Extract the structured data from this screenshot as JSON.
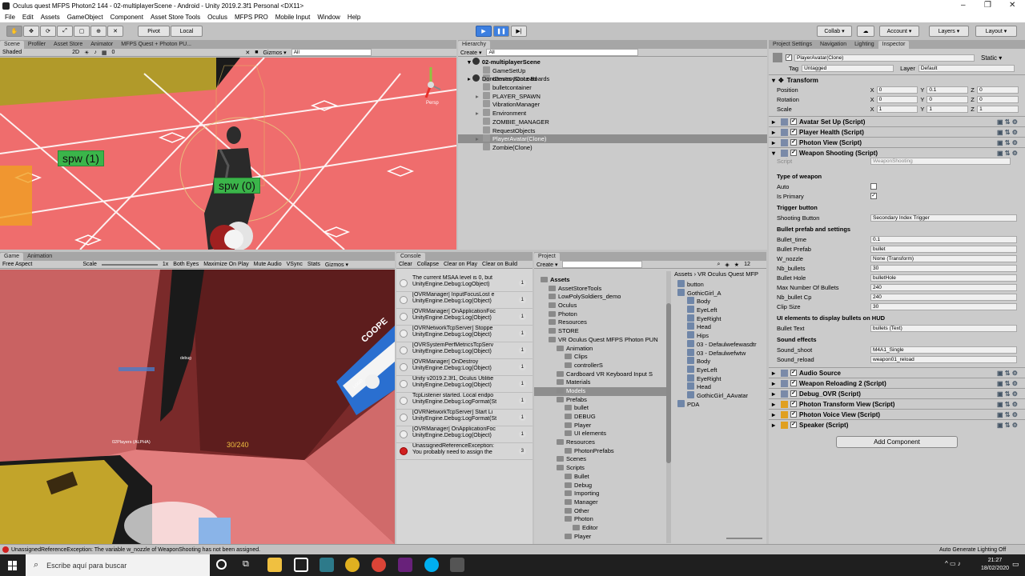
{
  "window": {
    "title": "Oculus quest MFPS Photon2 144 - 02-multiplayerScene - Android - Unity 2019.2.3f1 Personal <DX11>",
    "minimize": "–",
    "maximize": "❐",
    "close": "✕"
  },
  "menu": [
    "File",
    "Edit",
    "Assets",
    "GameObject",
    "Component",
    "Asset Store Tools",
    "Oculus",
    "MFPS PRO",
    "Mobile Input",
    "Window",
    "Help"
  ],
  "toolbar": {
    "pivot": "Pivot",
    "local": "Local",
    "collab": "Collab ▾",
    "account": "Account ▾",
    "layers": "Layers ▾",
    "layout": "Layout ▾"
  },
  "scene": {
    "tabs": [
      "Scene",
      "Profiler",
      "Asset Store",
      "Animator",
      "MFPS Quest + Photon PU..."
    ],
    "shaded": "Shaded",
    "mode2d": "2D",
    "gizmos": "Gizmos ▾",
    "search": "All",
    "persp": "Persp",
    "spw1": "spw (1)",
    "spw0": "spw (0)",
    "zero": "0"
  },
  "game": {
    "tabs": [
      "Game",
      "Animation"
    ],
    "aspect": "Free Aspect",
    "scale": "Scale",
    "scale_val": "1x",
    "both_eyes": "Both Eyes",
    "maximize": "Maximize On Play",
    "mute": "Mute Audio",
    "vsync": "VSync",
    "stats": "Stats",
    "gizmos": "Gizmos ▾",
    "ammo": "30/240",
    "player_label": "02Players (ALPHA)",
    "debug": "debug",
    "sign": "COOPE",
    "sign2": "LOGO"
  },
  "hierarchy": {
    "tab": "Hierarchy",
    "create": "Create ▾",
    "search": "All",
    "scene": "02-multiplayerScene",
    "items": [
      "GameSetUp",
      "canvas Score Boards",
      "bulletcontainer",
      "PLAYER_SPAWN",
      "VibrationManager",
      "Environment",
      "ZOMBIE_MANAGER",
      "RequestObjects",
      "PlayerAvatar(Clone)",
      "Zombie(Clone)"
    ],
    "dont_destroy": "DontDestroyOnLoad"
  },
  "console": {
    "tab": "Console",
    "clear": "Clear",
    "collapse": "Collapse",
    "clear_on_play": "Clear on Play",
    "clear_on_build": "Clear on Build",
    "logs": [
      {
        "l1": "The current MSAA level is 0, but",
        "l2": "UnityEngine.Debug:LogObject)",
        "n": "1"
      },
      {
        "l1": "[OVRManager] InputFocusLost e",
        "l2": "UnityEngine.Debug:Log(Object)",
        "n": "1"
      },
      {
        "l1": "[OVRManager] OnApplicationFoc",
        "l2": "UnityEngine.Debug:Log(Object)",
        "n": "1"
      },
      {
        "l1": "[OVRNetworkTcpServer] Stoppe",
        "l2": "UnityEngine.Debug:Log(Object)",
        "n": "1"
      },
      {
        "l1": "[OVRSystemPerfMetricsTcpServ",
        "l2": "UnityEngine.Debug:Log(Object)",
        "n": "1"
      },
      {
        "l1": "[OVRManager] OnDestroy",
        "l2": "UnityEngine.Debug:Log(Object)",
        "n": "1"
      },
      {
        "l1": "Unity v2019.2.3f1, Oculus Utilitie",
        "l2": "UnityEngine.Debug:Log(Object)",
        "n": "1"
      },
      {
        "l1": "TcpListener started. Local endpo",
        "l2": "UnityEngine.Debug:LogFormat(St",
        "n": "1"
      },
      {
        "l1": "[OVRNetworkTcpServer] Start Li",
        "l2": "UnityEngine.Debug:LogFormat(St",
        "n": "1"
      },
      {
        "l1": "[OVRManager] OnApplicationFoc",
        "l2": "UnityEngine.Debug:Log(Object)",
        "n": "1"
      },
      {
        "l1": "UnassignedReferenceException:",
        "l2": "You probably need to assign the",
        "n": "3"
      }
    ]
  },
  "project": {
    "tab": "Project",
    "create": "Create ▾",
    "count": "12",
    "breadcrumb": "Assets › VR Oculus Quest MFP",
    "tree": [
      {
        "t": "Assets",
        "d": 0,
        "b": true
      },
      {
        "t": "AssetStoreTools",
        "d": 1
      },
      {
        "t": "LowPolySoldiers_demo",
        "d": 1
      },
      {
        "t": "Oculus",
        "d": 1
      },
      {
        "t": "Photon",
        "d": 1
      },
      {
        "t": "Resources",
        "d": 1
      },
      {
        "t": "STORE",
        "d": 1
      },
      {
        "t": "VR Oculus Quest MFPS Photon PUN",
        "d": 1
      },
      {
        "t": "Animation",
        "d": 2
      },
      {
        "t": "Clips",
        "d": 3
      },
      {
        "t": "controllerS",
        "d": 3
      },
      {
        "t": "Cardboard VR Keyboard Input S",
        "d": 2
      },
      {
        "t": "Materials",
        "d": 2
      },
      {
        "t": "Models",
        "d": 2,
        "s": true
      },
      {
        "t": "Prefabs",
        "d": 2
      },
      {
        "t": "bullet",
        "d": 3
      },
      {
        "t": "DEBUG",
        "d": 3
      },
      {
        "t": "Player",
        "d": 3
      },
      {
        "t": "UI elements",
        "d": 3
      },
      {
        "t": "Resources",
        "d": 2
      },
      {
        "t": "PhotonPrefabs",
        "d": 3
      },
      {
        "t": "Scenes",
        "d": 2
      },
      {
        "t": "Scripts",
        "d": 2
      },
      {
        "t": "Bullet",
        "d": 3
      },
      {
        "t": "Debug",
        "d": 3
      },
      {
        "t": "Importing",
        "d": 3
      },
      {
        "t": "Manager",
        "d": 3
      },
      {
        "t": "Other",
        "d": 3
      },
      {
        "t": "Photon",
        "d": 3
      },
      {
        "t": "Editor",
        "d": 4
      },
      {
        "t": "Player",
        "d": 3
      }
    ],
    "assets": [
      {
        "t": "button",
        "d": 0
      },
      {
        "t": "GothicGirl_A",
        "d": 0
      },
      {
        "t": "Body",
        "d": 1
      },
      {
        "t": "EyeLeft",
        "d": 1
      },
      {
        "t": "EyeRight",
        "d": 1
      },
      {
        "t": "Head",
        "d": 1
      },
      {
        "t": "Hips",
        "d": 1
      },
      {
        "t": "03 - Defaulwefewasdtr",
        "d": 1
      },
      {
        "t": "03 - Defaulwefwtw",
        "d": 1
      },
      {
        "t": "Body",
        "d": 1
      },
      {
        "t": "EyeLeft",
        "d": 1
      },
      {
        "t": "EyeRight",
        "d": 1
      },
      {
        "t": "Head",
        "d": 1
      },
      {
        "t": "GothicGirl_AAvatar",
        "d": 1
      },
      {
        "t": "PDA",
        "d": 0
      }
    ]
  },
  "inspector": {
    "tabs": [
      "Project Settings",
      "Navigation",
      "Lighting",
      "Inspector"
    ],
    "object": "PlayerAvatar(Clone)",
    "static": "Static ▾",
    "tag_label": "Tag",
    "tag": "Untagged",
    "layer_label": "Layer",
    "layer": "Default",
    "transform": {
      "title": "Transform",
      "rows": [
        {
          "n": "Position",
          "x": "0",
          "y": "0.1",
          "z": "0"
        },
        {
          "n": "Rotation",
          "x": "0",
          "y": "0",
          "z": "0"
        },
        {
          "n": "Scale",
          "x": "1",
          "y": "1",
          "z": "1"
        }
      ]
    },
    "components_top": [
      "Avatar Set Up (Script)",
      "Player Health (Script)",
      "Photon View (Script)",
      "Weapon Shooting (Script)"
    ],
    "script_label": "Script",
    "script_val": "WeaponShooting",
    "fields": [
      {
        "h": "Type of weapon"
      },
      {
        "n": "Auto",
        "c": false
      },
      {
        "n": "Is Primary",
        "c": true
      },
      {
        "h": "Trigger button"
      },
      {
        "n": "Shooting Button",
        "v": "Secondary Index Trigger"
      },
      {
        "h": "Bullet prefab and settings"
      },
      {
        "n": "Bullet_time",
        "v": "0.1"
      },
      {
        "n": "Bullet Prefab",
        "v": "bullet"
      },
      {
        "n": "W_nozzle",
        "v": "None (Transform)"
      },
      {
        "n": "Nb_bullets",
        "v": "30"
      },
      {
        "n": "Bullet Hole",
        "v": "bulletHole"
      },
      {
        "n": "Max Number Of Bullets",
        "v": "240"
      },
      {
        "n": "Nb_bullet Cp",
        "v": "240"
      },
      {
        "n": "Clip Size",
        "v": "30"
      },
      {
        "h": "UI elements to display bullets on HUD"
      },
      {
        "n": "Bullet Text",
        "v": "bullets (Text)"
      },
      {
        "h": "Sound effects"
      },
      {
        "n": "Sound_shoot",
        "v": "M4A1_Single"
      },
      {
        "n": "Sound_reload",
        "v": "weapon01_reload"
      }
    ],
    "components_bottom": [
      "Audio Source",
      "Weapon Reloading 2 (Script)",
      "Debug_OVR (Script)",
      "Photon Transform View (Script)",
      "Photon Voice View (Script)",
      "Speaker (Script)"
    ],
    "add_component": "Add Component"
  },
  "status": {
    "error": "UnassignedReferenceException: The variable w_nozzle of WeaponShooting has not been assigned.",
    "right": "Auto Generate Lighting Off"
  },
  "taskbar": {
    "search": "Escribe aquí para buscar",
    "time": "21:27",
    "date": "18/02/2020"
  }
}
